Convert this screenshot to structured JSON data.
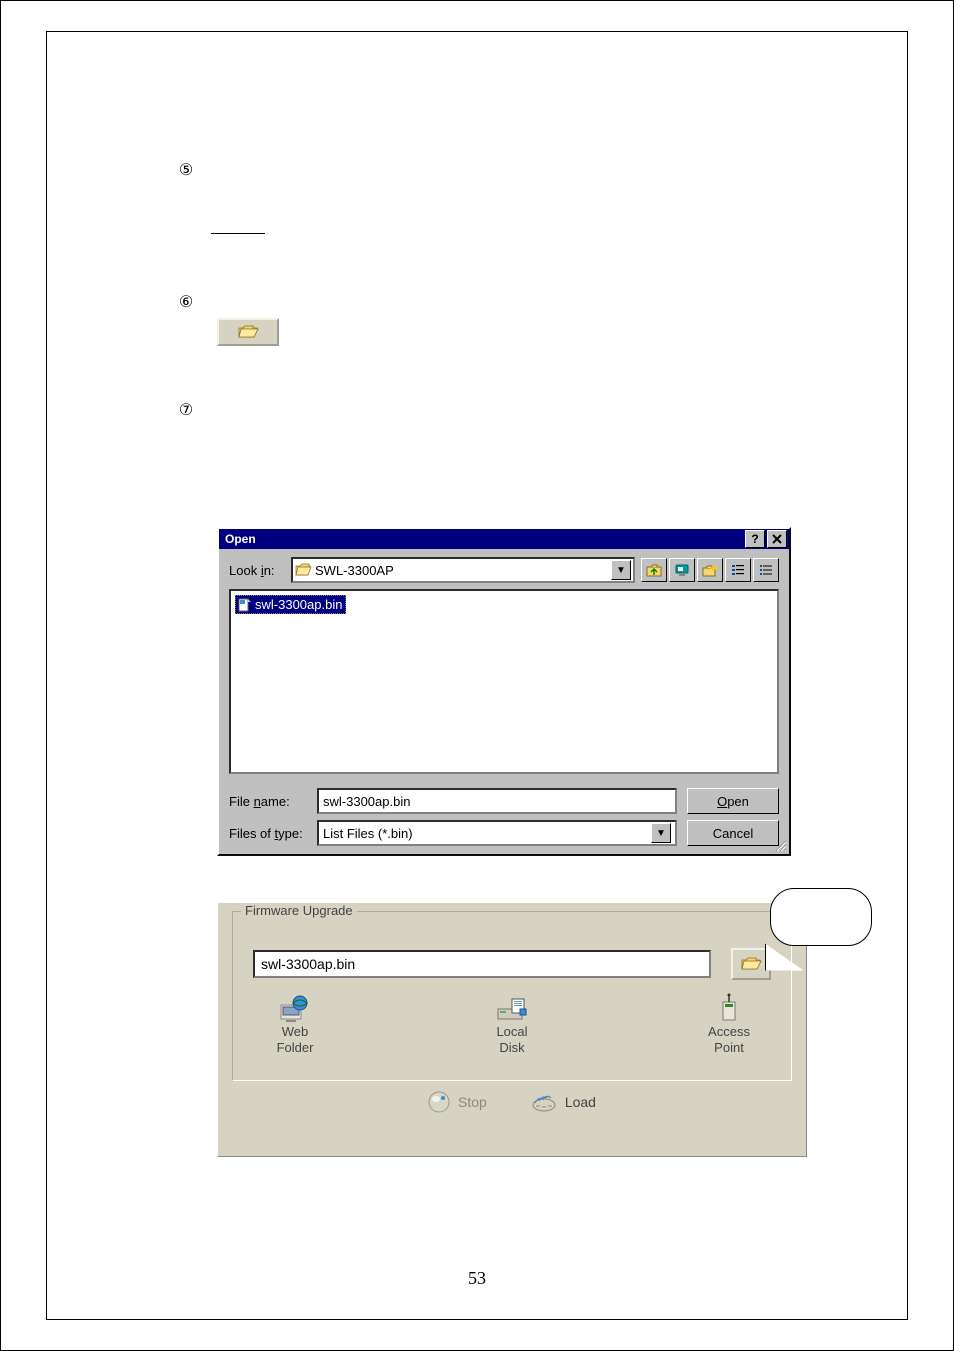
{
  "page_number": "53",
  "steps": {
    "s5": {
      "num": "⑤"
    },
    "s6": {
      "num": "⑥"
    },
    "s7": {
      "num": "⑦"
    }
  },
  "open_dialog": {
    "title": "Open",
    "help": "?",
    "close": "×",
    "look_in_label": "Look in:",
    "look_in_value": "SWL-3300AP",
    "selected_file": "swl-3300ap.bin",
    "file_name_label": "File name:",
    "file_name_value": "swl-3300ap.bin",
    "file_type_label": "Files of type:",
    "file_type_value": "List Files (*.bin)",
    "open_btn": "Open",
    "cancel_btn": "Cancel",
    "open_mnemonic": "O",
    "lookin_mnemonic": "i",
    "name_mnemonic": "n",
    "type_mnemonic": "t",
    "toolbar_icons": [
      "up-folder-icon",
      "desktop-icon",
      "new-folder-icon",
      "list-view-icon",
      "details-view-icon"
    ]
  },
  "firmware": {
    "legend": "Firmware Upgrade",
    "path": "swl-3300ap.bin",
    "cols": {
      "web": {
        "l1": "Web",
        "l2": "Folder"
      },
      "local": {
        "l1": "Local",
        "l2": "Disk"
      },
      "ap": {
        "l1": "Access",
        "l2": "Point"
      }
    },
    "stop": "Stop",
    "load": "Load"
  }
}
